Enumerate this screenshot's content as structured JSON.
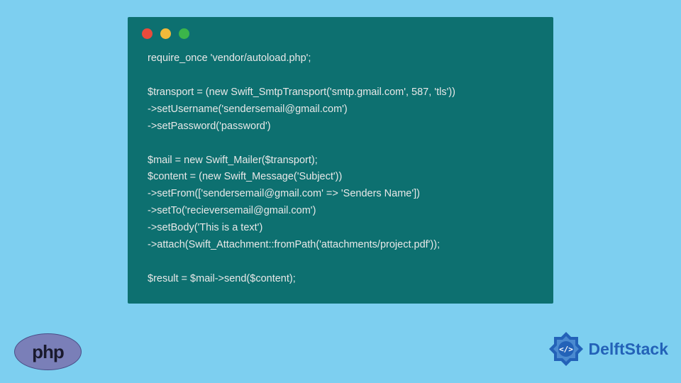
{
  "code": {
    "lines": [
      "require_once 'vendor/autoload.php';",
      "",
      "$transport = (new Swift_SmtpTransport('smtp.gmail.com', 587, 'tls'))",
      "->setUsername('sendersemail@gmail.com')",
      "->setPassword('password')",
      "",
      "$mail = new Swift_Mailer($transport);",
      "$content = (new Swift_Message('Subject'))",
      "->setFrom(['sendersemail@gmail.com' => 'Senders Name'])",
      "->setTo('recieversemail@gmail.com')",
      "->setBody('This is a text')",
      "->attach(Swift_Attachment::fromPath('attachments/project.pdf'));",
      "",
      "$result = $mail->send($content);"
    ]
  },
  "logos": {
    "php_label": "php",
    "delft_label": "DelftStack"
  }
}
